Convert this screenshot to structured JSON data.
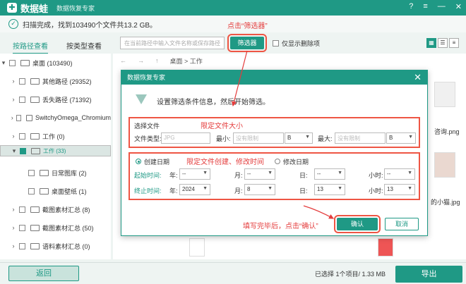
{
  "app": {
    "name": "数据蛙",
    "subtitle": "数据恢复专家"
  },
  "status": {
    "text": "扫描完成，找到103490个文件共13.2 GB。"
  },
  "tabs": [
    {
      "label": "按路径查看"
    },
    {
      "label": "按类型查看"
    }
  ],
  "search": {
    "placeholder": "在当前路径中输入文件名称或保存路径"
  },
  "toolbar": {
    "filter_label": "筛选器",
    "show_deleted_label": "仅显示删除项"
  },
  "annotations": {
    "click_filter": "点击“筛选器”",
    "limit_size": "限定文件大小",
    "limit_time": "限定文件创建、修改时间",
    "after_fill": "填写完毕后，点击“确认”"
  },
  "tree": [
    {
      "label": "桌面 (103490)"
    },
    {
      "label": "其他路径 (29352)"
    },
    {
      "label": "丢失路径 (71392)"
    },
    {
      "label": "SwitchyOmega_Chromium"
    },
    {
      "label": "工作 (0)"
    },
    {
      "label": "工作 (33)"
    },
    {
      "label": "日常图库 (2)"
    },
    {
      "label": "桌面壁纸 (1)"
    },
    {
      "label": "截图素材汇总 (8)"
    },
    {
      "label": "截图素材汇总 (50)"
    },
    {
      "label": "语料素材汇总 (0)"
    }
  ],
  "breadcrumb": {
    "path": "桌面 > 工作"
  },
  "thumbs": {
    "text1": "咨询.png",
    "text2": "的小猫.jpg"
  },
  "dialog": {
    "title": "数据恢复专家",
    "description": "设置筛选条件信息，然后开始筛选。",
    "file_section_label": "选择文件",
    "file_type_label": "文件类型:",
    "file_type_placeholder": "JPG",
    "min_label": "最小:",
    "min_placeholder": "没有限制",
    "min_unit": "B",
    "max_label": "最大:",
    "max_placeholder": "没有限制",
    "max_unit": "B",
    "created_label": "创建日期",
    "modified_label": "修改日期",
    "start_label": "起始时间:",
    "end_label": "终止时间:",
    "year_label": "年:",
    "month_label": "月:",
    "day_label": "日:",
    "hour_label": "小时:",
    "start": {
      "year": "--",
      "month": "--",
      "day": "--",
      "hour": "--"
    },
    "end": {
      "year": "2024",
      "month": "8",
      "day": "13",
      "hour": "13"
    },
    "confirm_label": "确认",
    "cancel_label": "取消"
  },
  "footer": {
    "back_label": "返回",
    "selection_info": "已选择 1个项目/ 1.33 MB",
    "export_label": "导出"
  },
  "colors": {
    "brand": "#1f9985",
    "annotation": "#e43c3c"
  }
}
